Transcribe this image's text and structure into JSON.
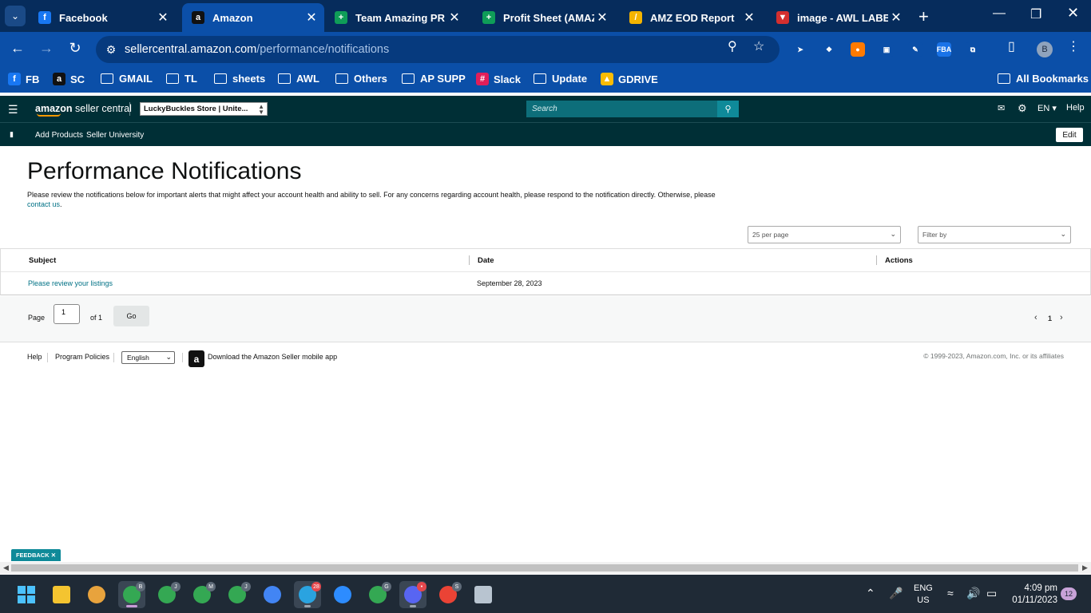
{
  "browser": {
    "tabs": [
      {
        "title": "Facebook",
        "icon": "facebook-icon",
        "color": "#1877f2",
        "glyph": "f"
      },
      {
        "title": "Amazon",
        "icon": "amazon-icon",
        "color": "#111111",
        "glyph": "a"
      },
      {
        "title": "Team Amazing PR - C",
        "icon": "google-sheets-icon",
        "color": "#0f9d58",
        "glyph": "+"
      },
      {
        "title": "Profit Sheet (AMAZI",
        "icon": "google-sheets-icon",
        "color": "#0f9d58",
        "glyph": "+"
      },
      {
        "title": "AMZ EOD Report",
        "icon": "report-icon",
        "color": "#f4b400",
        "glyph": "/"
      },
      {
        "title": "image - AWL LABEL",
        "icon": "image-icon",
        "color": "#d32f2f",
        "glyph": "▼"
      }
    ],
    "url_domain": "sellercentral.amazon.com",
    "url_path": "/performance/notifications",
    "profile_initial": "B",
    "bookmarks": [
      {
        "label": "FB",
        "type": "fav",
        "color": "#1877f2",
        "glyph": "f"
      },
      {
        "label": "SC",
        "type": "fav",
        "color": "#111111",
        "glyph": "a"
      },
      {
        "label": "GMAIL",
        "type": "folder"
      },
      {
        "label": "TL",
        "type": "folder"
      },
      {
        "label": "sheets",
        "type": "folder"
      },
      {
        "label": "AWL",
        "type": "folder"
      },
      {
        "label": "Others",
        "type": "folder"
      },
      {
        "label": "AP SUPP",
        "type": "folder"
      },
      {
        "label": "Slack",
        "type": "fav",
        "color": "#e01e5a",
        "glyph": "#"
      },
      {
        "label": "Update",
        "type": "folder"
      },
      {
        "label": "GDRIVE",
        "type": "fav",
        "color": "#fbbc04",
        "glyph": "▲"
      }
    ],
    "all_bookmarks": "All Bookmarks",
    "extensions": [
      {
        "name": "cursor-extension-icon",
        "color": "#0b4fa8",
        "glyph": "➤"
      },
      {
        "name": "puzzle-extension-icon",
        "color": "#0b4fa8",
        "glyph": "❖"
      },
      {
        "name": "circle-extension-icon",
        "color": "#ff7a00",
        "glyph": "●"
      },
      {
        "name": "camera-extension-icon",
        "color": "#0b4fa8",
        "glyph": "▣"
      },
      {
        "name": "pen-extension-icon",
        "color": "#0b4fa8",
        "glyph": "✎"
      },
      {
        "name": "fba-extension-icon",
        "color": "#1a73e8",
        "glyph": "FBA"
      },
      {
        "name": "extensions-icon",
        "color": "#0b4fa8",
        "glyph": "⧉"
      }
    ]
  },
  "seller_central": {
    "logo_prefix": "amazon",
    "logo_suffix": " seller central",
    "store": "LuckyBuckles Store | Unite...",
    "search_placeholder": "Search",
    "lang": "EN ▾",
    "help": "Help",
    "sub_links": [
      "Add Products",
      "Seller University"
    ],
    "edit": "Edit"
  },
  "page": {
    "title": "Performance Notifications",
    "description": "Please review the notifications below for important alerts that might affect your account health and ability to sell. For any concerns regarding account health, please respond to the notification directly. Otherwise, please",
    "contact_link": "contact us",
    "per_page": "25 per page",
    "filter": "Filter by",
    "columns": {
      "subject": "Subject",
      "date": "Date",
      "actions": "Actions"
    },
    "rows": [
      {
        "subject": "Please review your listings",
        "date": "September 28, 2023"
      }
    ],
    "pager": {
      "page_label": "Page",
      "current": "1",
      "of_label": "of 1",
      "go": "Go",
      "page_num": "1"
    }
  },
  "footer": {
    "help": "Help",
    "program_policies": "Program Policies",
    "language": "English",
    "app_download": "Download the Amazon Seller mobile app",
    "copyright": "© 1999-2023, Amazon.com, Inc. or its affiliates"
  },
  "feedback_label": "FEEDBACK ✕",
  "taskbar": {
    "apps": [
      {
        "name": "file-explorer-icon",
        "color": "#f4c430"
      },
      {
        "name": "app-character-icon",
        "color": "#e8a33d"
      },
      {
        "name": "chrome-icon",
        "color": "#34a853",
        "badge": "B",
        "active": true,
        "selected": true
      },
      {
        "name": "chrome-icon",
        "color": "#34a853",
        "badge": "J"
      },
      {
        "name": "chrome-icon",
        "color": "#34a853",
        "badge": "M"
      },
      {
        "name": "chrome-icon",
        "color": "#34a853",
        "badge": "J"
      },
      {
        "name": "chrome-icon",
        "color": "#4285f4",
        "badge": ""
      },
      {
        "name": "telegram-icon",
        "color": "#2aa3e0",
        "badge": "28",
        "active": true
      },
      {
        "name": "zoom-icon",
        "color": "#2d8cff",
        "badge": ""
      },
      {
        "name": "chrome-icon",
        "color": "#34a853",
        "badge": "G"
      },
      {
        "name": "discord-icon",
        "color": "#5865f2",
        "badge": "•",
        "active": true
      },
      {
        "name": "chrome-icon",
        "color": "#ea4335",
        "badge": "S"
      },
      {
        "name": "calculator-icon",
        "color": "#b8c4d0",
        "badge": ""
      }
    ],
    "lang_top": "ENG",
    "lang_bottom": "US",
    "time": "4:09 pm",
    "date": "01/11/2023",
    "notifications": "12"
  }
}
